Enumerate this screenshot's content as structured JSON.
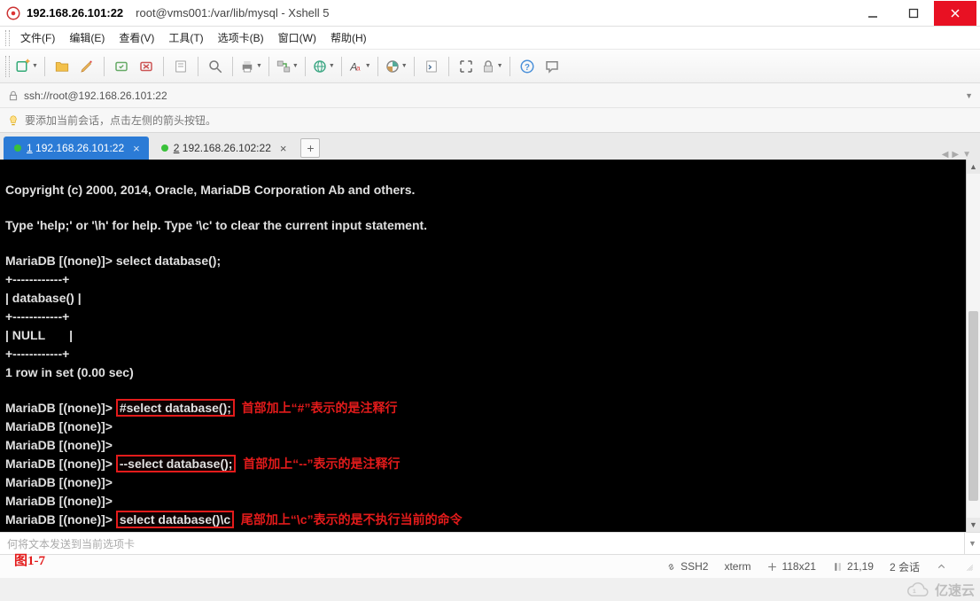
{
  "titlebar": {
    "ip": "192.168.26.101:22",
    "path": "root@vms001:/var/lib/mysql - Xshell 5"
  },
  "menu": {
    "file": "文件(F)",
    "edit": "编辑(E)",
    "view": "查看(V)",
    "tools": "工具(T)",
    "tabs": "选项卡(B)",
    "window": "窗口(W)",
    "help": "帮助(H)"
  },
  "address": {
    "url": "ssh://root@192.168.26.101:22"
  },
  "hint": {
    "text": "要添加当前会话，点击左侧的箭头按钮。"
  },
  "tabs": {
    "t1_num": "1",
    "t1_label": "192.168.26.101:22",
    "t2_num": "2",
    "t2_label": "192.168.26.102:22"
  },
  "term": {
    "copyright": "Copyright (c) 2000, 2014, Oracle, MariaDB Corporation Ab and others.",
    "typehelp": "Type 'help;' or '\\h' for help. Type '\\c' to clear the current input statement.",
    "prompt": "MariaDB [(none)]>",
    "cmd_sel": "select database();",
    "sep": "+------------+",
    "hdr": "| database() |",
    "nullrow": "| NULL       |",
    "rowset": "1 row in set (0.00 sec)",
    "hl1": "#select database();",
    "a1": "首部加上“#”表示的是注释行",
    "hl2": "--select database();",
    "a2": "首部加上“--”表示的是注释行",
    "hl3": "select database()\\c",
    "a3": "尾部加上“\\c”表示的是不执行当前的命令"
  },
  "input": {
    "placeholder": "何将文本发送到当前选项卡"
  },
  "figure": {
    "label": "图1-7"
  },
  "status": {
    "proto": "SSH2",
    "term": "xterm",
    "size": "118x21",
    "pos": "21,19",
    "sess": "2 会话"
  },
  "watermark": {
    "text": "亿速云"
  }
}
